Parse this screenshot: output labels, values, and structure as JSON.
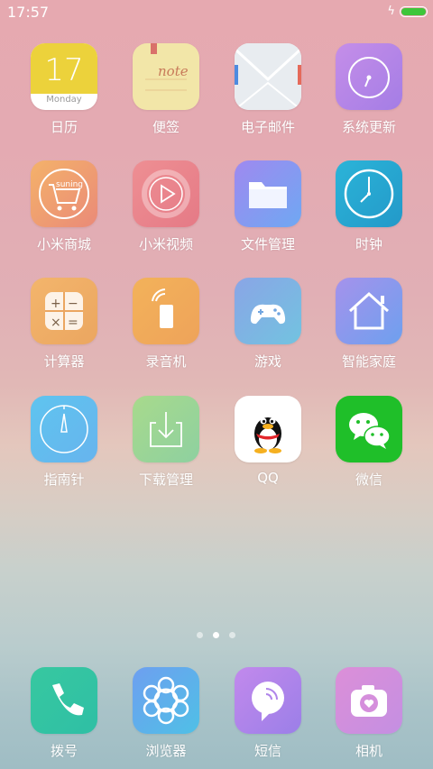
{
  "status": {
    "time": "17:57",
    "battery_level": 1.0
  },
  "apps": {
    "calendar": {
      "label": "日历",
      "day": "17",
      "weekday": "Monday"
    },
    "notes": {
      "label": "便签",
      "text": "note"
    },
    "email": {
      "label": "电子邮件"
    },
    "updater": {
      "label": "系统更新"
    },
    "mall": {
      "label": "小米商城",
      "text": "suning"
    },
    "video": {
      "label": "小米视频"
    },
    "files": {
      "label": "文件管理"
    },
    "clock": {
      "label": "时钟"
    },
    "calculator": {
      "label": "计算器"
    },
    "recorder": {
      "label": "录音机"
    },
    "games": {
      "label": "游戏"
    },
    "smarthome": {
      "label": "智能家庭"
    },
    "compass": {
      "label": "指南针"
    },
    "downloads": {
      "label": "下载管理"
    },
    "qq": {
      "label": "QQ"
    },
    "wechat": {
      "label": "微信"
    }
  },
  "pager": {
    "pages": 3,
    "active": 2
  },
  "dock": {
    "phone": {
      "label": "拨号"
    },
    "browser": {
      "label": "浏览器"
    },
    "sms": {
      "label": "短信"
    },
    "camera": {
      "label": "相机"
    }
  }
}
